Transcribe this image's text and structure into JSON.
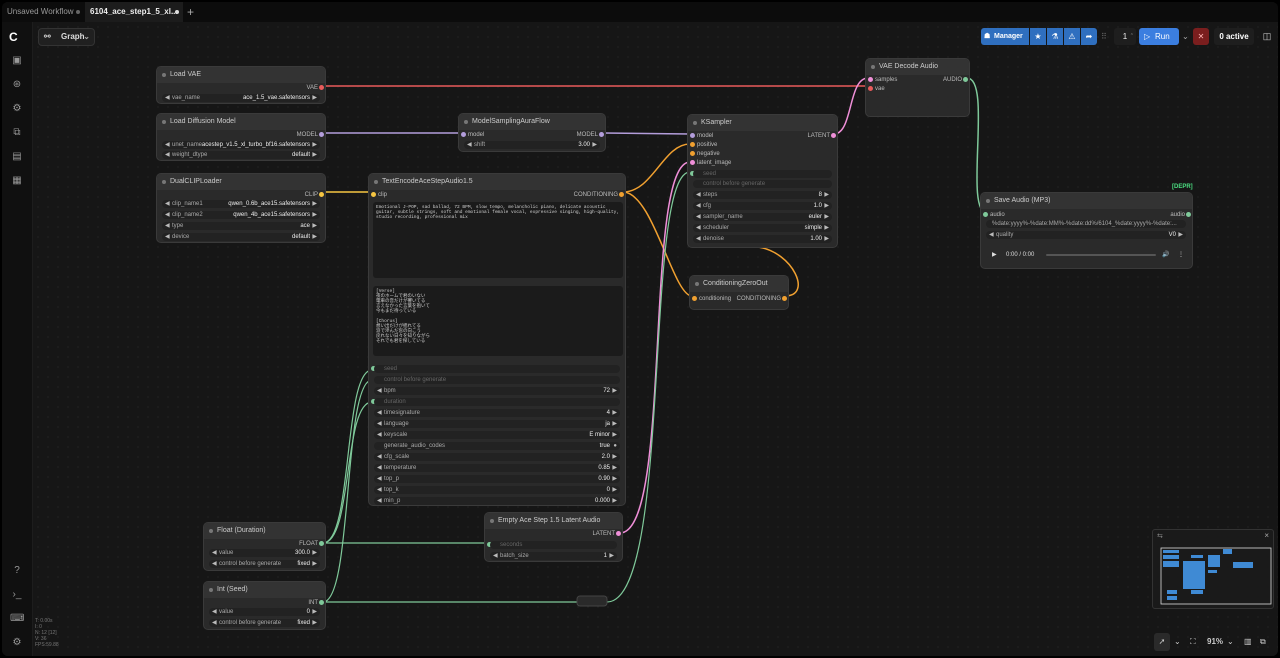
{
  "tabs": [
    {
      "label": "Unsaved Workflow"
    },
    {
      "label": "6104_ace_step1_5_xl..."
    }
  ],
  "toolbar": {
    "graph_label": "Graph",
    "manager_label": "Manager",
    "queue_count": "1",
    "run_label": "Run",
    "active_label": "0 active"
  },
  "colors": {
    "vae": "#e85a5a",
    "model": "#b39ddb",
    "clip": "#f5c542",
    "conditioning": "#f0a030",
    "latent": "#ef8fd8",
    "audio": "#7fc99a",
    "float": "#7fc99a",
    "int": "#7fc99a"
  },
  "nodes": {
    "load_vae": {
      "title": "Load VAE",
      "out": "VAE",
      "w_name": "vae_name",
      "w_value": "ace_1.5_vae.safetensors"
    },
    "load_diffusion": {
      "title": "Load Diffusion Model",
      "out": "MODEL",
      "w1_name": "unet_name",
      "w1_value": "acestep_v1.5_xl_turbo_bf16.safetensors",
      "w2_name": "weight_dtype",
      "w2_value": "default"
    },
    "dual_clip": {
      "title": "DualCLIPLoader",
      "out": "CLIP",
      "w1_name": "clip_name1",
      "w1_value": "qwen_0.6b_ace15.safetensors",
      "w2_name": "clip_name2",
      "w2_value": "qwen_4b_ace15.safetensors",
      "w3_name": "type",
      "w3_value": "ace",
      "w4_name": "device",
      "w4_value": "default"
    },
    "model_sampling": {
      "title": "ModelSamplingAuraFlow",
      "in": "model",
      "out": "MODEL",
      "w_name": "shift",
      "w_value": "3.00"
    },
    "text_encode": {
      "title": "TextEncodeAceStepAudio1.5",
      "in": "clip",
      "out": "CONDITIONING",
      "tags": "Emotional J-POP, sad ballad, 72 BPM, slow tempo, melancholic piano, delicate acoustic guitar, subtle strings, soft and emotional female vocal, expressive singing, high-quality, studio recording, professional mix",
      "lyrics": "[Verse]\n夜のホームで君のいない\n電車の音だけが響いてる\n言えなかった言葉を抱いて\n今もまだ待っている\n\n[Chorus]\n想い出だけが揺れてる\n涙で滲んだ窓の向こう\n戻れない日々を知りながら\nそれでも君を探している",
      "seed": "seed",
      "cag": "control before generate",
      "bpm_name": "bpm",
      "bpm_value": "72",
      "duration": "duration",
      "ts_name": "timesignature",
      "ts_value": "4",
      "lang_name": "language",
      "lang_value": "ja",
      "key_name": "keyscale",
      "key_value": "E minor",
      "gac_name": "generate_audio_codes",
      "gac_value": "true",
      "cfg_name": "cfg_scale",
      "cfg_value": "2.0",
      "temp_name": "temperature",
      "temp_value": "0.85",
      "topp_name": "top_p",
      "topp_value": "0.90",
      "topk_name": "top_k",
      "topk_value": "0",
      "minp_name": "min_p",
      "minp_value": "0.000"
    },
    "ksampler": {
      "title": "KSampler",
      "in1": "model",
      "in2": "positive",
      "in3": "negative",
      "in4": "latent_image",
      "out": "LATENT",
      "seed": "seed",
      "cag": "control before generate",
      "steps_name": "steps",
      "steps_value": "8",
      "cfg_name": "cfg",
      "cfg_value": "1.0",
      "sampler_name": "sampler_name",
      "sampler_value": "euler",
      "sched_name": "scheduler",
      "sched_value": "simple",
      "denoise_name": "denoise",
      "denoise_value": "1.00"
    },
    "cond_zero": {
      "title": "ConditioningZeroOut",
      "in": "conditioning",
      "out": "CONDITIONING"
    },
    "vae_decode": {
      "title": "VAE Decode Audio",
      "in1": "samples",
      "in2": "vae",
      "out": "AUDIO"
    },
    "save_audio": {
      "tag": "[DEPR]",
      "title": "Save Audio (MP3)",
      "in": "audio",
      "out": "audio",
      "prefix": "%date:yyyy%-%date:MM%-%date:dd%/6104_%date:yyyy%-%date:...",
      "q_name": "quality",
      "q_value": "V0",
      "time": "0:00 / 0:00"
    },
    "float_duration": {
      "title": "Float (Duration)",
      "out": "FLOAT",
      "w1_name": "value",
      "w1_value": "300.0",
      "w2_name": "control before generate",
      "w2_value": "fixed"
    },
    "int_seed": {
      "title": "Int (Seed)",
      "out": "INT",
      "w1_name": "value",
      "w1_value": "0",
      "w2_name": "control before generate",
      "w2_value": "fixed"
    },
    "empty_latent": {
      "title": "Empty Ace Step 1.5 Latent Audio",
      "out": "LATENT",
      "duration": "seconds",
      "batch_name": "batch_size",
      "batch_value": "1"
    }
  },
  "zoom": "91%",
  "stats": [
    "T: 0.00s",
    "I: 0",
    "N: 12 [12]",
    "V: 36",
    "FPS:59.88"
  ]
}
